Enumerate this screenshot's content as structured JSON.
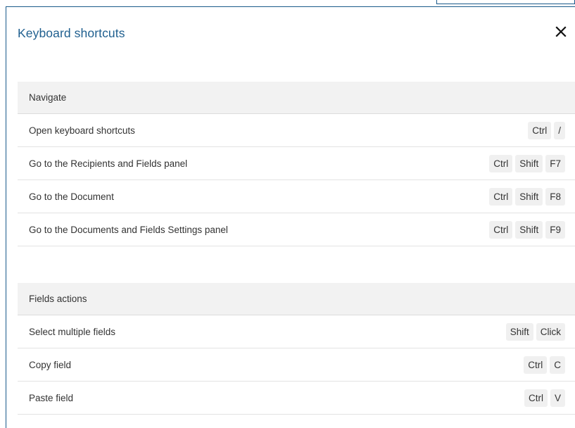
{
  "dialog": {
    "title": "Keyboard shortcuts",
    "close_icon": "close-icon"
  },
  "sections": [
    {
      "title": "Navigate",
      "rows": [
        {
          "label": "Open keyboard shortcuts",
          "keys": [
            "Ctrl",
            "/"
          ]
        },
        {
          "label": "Go to the Recipients and Fields panel",
          "keys": [
            "Ctrl",
            "Shift",
            "F7"
          ]
        },
        {
          "label": "Go to the Document",
          "keys": [
            "Ctrl",
            "Shift",
            "F8"
          ]
        },
        {
          "label": "Go to the Documents and Fields Settings panel",
          "keys": [
            "Ctrl",
            "Shift",
            "F9"
          ]
        }
      ]
    },
    {
      "title": "Fields actions",
      "rows": [
        {
          "label": "Select multiple fields",
          "keys": [
            "Shift",
            "Click"
          ]
        },
        {
          "label": "Copy field",
          "keys": [
            "Ctrl",
            "C"
          ]
        },
        {
          "label": "Paste field",
          "keys": [
            "Ctrl",
            "V"
          ]
        }
      ]
    }
  ],
  "colors": {
    "title": "#1f5f8f",
    "border": "#1a5a8a",
    "section_bg": "#f2f2f2",
    "key_bg": "#f0f0f0"
  }
}
